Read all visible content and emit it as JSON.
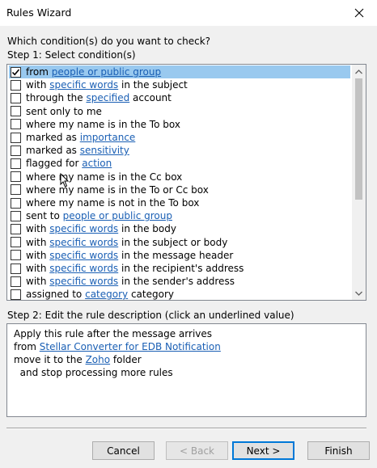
{
  "window": {
    "title": "Rules Wizard",
    "close_icon": "close-icon"
  },
  "prompt": "Which condition(s) do you want to check?",
  "step1_label": "Step 1: Select condition(s)",
  "conditions": [
    {
      "checked": true,
      "selected": true,
      "parts": [
        [
          "from ",
          false
        ],
        [
          "people or public group",
          true
        ]
      ]
    },
    {
      "checked": false,
      "selected": false,
      "parts": [
        [
          "with ",
          false
        ],
        [
          "specific words",
          true
        ],
        [
          " in the subject",
          false
        ]
      ]
    },
    {
      "checked": false,
      "selected": false,
      "parts": [
        [
          "through the ",
          false
        ],
        [
          "specified",
          true
        ],
        [
          " account",
          false
        ]
      ]
    },
    {
      "checked": false,
      "selected": false,
      "parts": [
        [
          "sent only to me",
          false
        ]
      ]
    },
    {
      "checked": false,
      "selected": false,
      "parts": [
        [
          "where my name is in the To box",
          false
        ]
      ]
    },
    {
      "checked": false,
      "selected": false,
      "parts": [
        [
          "marked as ",
          false
        ],
        [
          "importance",
          true
        ]
      ]
    },
    {
      "checked": false,
      "selected": false,
      "parts": [
        [
          "marked as ",
          false
        ],
        [
          "sensitivity",
          true
        ]
      ]
    },
    {
      "checked": false,
      "selected": false,
      "parts": [
        [
          "flagged for ",
          false
        ],
        [
          "action",
          true
        ]
      ]
    },
    {
      "checked": false,
      "selected": false,
      "parts": [
        [
          "where my name is in the Cc box",
          false
        ]
      ]
    },
    {
      "checked": false,
      "selected": false,
      "parts": [
        [
          "where my name is in the To or Cc box",
          false
        ]
      ]
    },
    {
      "checked": false,
      "selected": false,
      "parts": [
        [
          "where my name is not in the To box",
          false
        ]
      ]
    },
    {
      "checked": false,
      "selected": false,
      "parts": [
        [
          "sent to ",
          false
        ],
        [
          "people or public group",
          true
        ]
      ]
    },
    {
      "checked": false,
      "selected": false,
      "parts": [
        [
          "with ",
          false
        ],
        [
          "specific words",
          true
        ],
        [
          " in the body",
          false
        ]
      ]
    },
    {
      "checked": false,
      "selected": false,
      "parts": [
        [
          "with ",
          false
        ],
        [
          "specific words",
          true
        ],
        [
          " in the subject or body",
          false
        ]
      ]
    },
    {
      "checked": false,
      "selected": false,
      "parts": [
        [
          "with ",
          false
        ],
        [
          "specific words",
          true
        ],
        [
          " in the message header",
          false
        ]
      ]
    },
    {
      "checked": false,
      "selected": false,
      "parts": [
        [
          "with ",
          false
        ],
        [
          "specific words",
          true
        ],
        [
          " in the recipient's address",
          false
        ]
      ]
    },
    {
      "checked": false,
      "selected": false,
      "parts": [
        [
          "with ",
          false
        ],
        [
          "specific words",
          true
        ],
        [
          " in the sender's address",
          false
        ]
      ]
    },
    {
      "checked": false,
      "selected": false,
      "parts": [
        [
          "assigned to ",
          false
        ],
        [
          "category",
          true
        ],
        [
          " category",
          false
        ]
      ]
    }
  ],
  "step2_label": "Step 2: Edit the rule description (click an underlined value)",
  "description": [
    {
      "parts": [
        [
          "Apply this rule after the message arrives",
          false
        ]
      ]
    },
    {
      "parts": [
        [
          "from ",
          false
        ],
        [
          "Stellar Converter for EDB Notification",
          true
        ]
      ]
    },
    {
      "parts": [
        [
          "move it to the ",
          false
        ],
        [
          "Zoho",
          true
        ],
        [
          " folder",
          false
        ]
      ]
    },
    {
      "parts": [
        [
          "  and stop processing more rules",
          false
        ]
      ]
    }
  ],
  "buttons": {
    "cancel": "Cancel",
    "back": "< Back",
    "next": "Next >",
    "finish": "Finish"
  },
  "colors": {
    "link": "#1a5fb4",
    "selection": "#99c9ef",
    "default_button_border": "#0078d7"
  }
}
